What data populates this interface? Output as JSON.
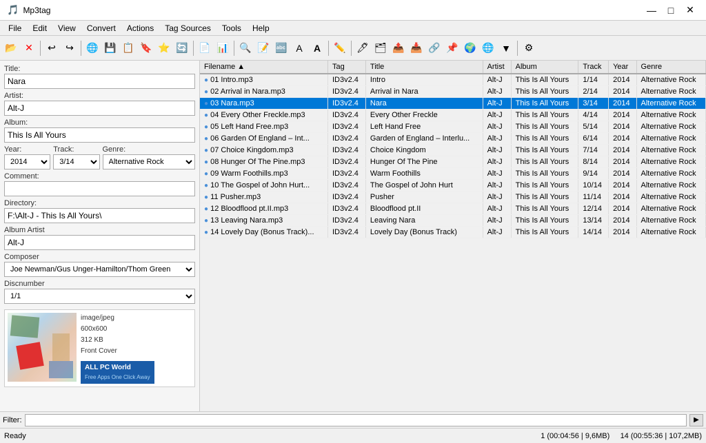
{
  "app": {
    "title": "Mp3tag",
    "icon": "🎵"
  },
  "titlebar": {
    "minimize": "—",
    "maximize": "□",
    "close": "✕"
  },
  "menu": {
    "items": [
      "File",
      "Edit",
      "View",
      "Convert",
      "Actions",
      "Tag Sources",
      "Tools",
      "Help"
    ]
  },
  "left_panel": {
    "title_label": "Title:",
    "title_value": "Nara",
    "artist_label": "Artist:",
    "artist_value": "Alt-J",
    "album_label": "Album:",
    "album_value": "This Is All Yours",
    "year_label": "Year:",
    "year_value": "2014",
    "track_label": "Track:",
    "track_value": "3/14",
    "genre_label": "Genre:",
    "genre_value": "Alternative Rock",
    "comment_label": "Comment:",
    "comment_value": "",
    "directory_label": "Directory:",
    "directory_value": "F:\\Alt-J - This Is All Yours\\",
    "album_artist_label": "Album Artist",
    "album_artist_value": "Alt-J",
    "composer_label": "Composer",
    "composer_value": "Joe Newman/Gus Unger-Hamilton/Thom Green",
    "discnumber_label": "Discnumber",
    "discnumber_value": "1/1",
    "art_type": "image/jpeg",
    "art_dims": "600x600",
    "art_size": "312 KB",
    "art_label": "Front Cover",
    "watermark_title": "ALL PC World",
    "watermark_sub": "Free Apps One Click Away"
  },
  "table": {
    "columns": [
      "Filename",
      "Tag",
      "Title",
      "Artist",
      "Album",
      "Track",
      "Year",
      "Genre"
    ],
    "rows": [
      {
        "filename": "01 Intro.mp3",
        "tag": "ID3v2.4",
        "title": "Intro",
        "artist": "Alt-J",
        "album": "This Is All Yours",
        "track": "1/14",
        "year": "2014",
        "genre": "Alternative Rock",
        "selected": false
      },
      {
        "filename": "02 Arrival in Nara.mp3",
        "tag": "ID3v2.4",
        "title": "Arrival in Nara",
        "artist": "Alt-J",
        "album": "This Is All Yours",
        "track": "2/14",
        "year": "2014",
        "genre": "Alternative Rock",
        "selected": false
      },
      {
        "filename": "03 Nara.mp3",
        "tag": "ID3v2.4",
        "title": "Nara",
        "artist": "Alt-J",
        "album": "This Is All Yours",
        "track": "3/14",
        "year": "2014",
        "genre": "Alternative Rock",
        "selected": true
      },
      {
        "filename": "04 Every Other Freckle.mp3",
        "tag": "ID3v2.4",
        "title": "Every Other Freckle",
        "artist": "Alt-J",
        "album": "This Is All Yours",
        "track": "4/14",
        "year": "2014",
        "genre": "Alternative Rock",
        "selected": false
      },
      {
        "filename": "05 Left Hand Free.mp3",
        "tag": "ID3v2.4",
        "title": "Left Hand Free",
        "artist": "Alt-J",
        "album": "This Is All Yours",
        "track": "5/14",
        "year": "2014",
        "genre": "Alternative Rock",
        "selected": false
      },
      {
        "filename": "06 Garden Of England – Int...",
        "tag": "ID3v2.4",
        "title": "Garden of England – Interlu...",
        "artist": "Alt-J",
        "album": "This Is All Yours",
        "track": "6/14",
        "year": "2014",
        "genre": "Alternative Rock",
        "selected": false
      },
      {
        "filename": "07 Choice Kingdom.mp3",
        "tag": "ID3v2.4",
        "title": "Choice Kingdom",
        "artist": "Alt-J",
        "album": "This Is All Yours",
        "track": "7/14",
        "year": "2014",
        "genre": "Alternative Rock",
        "selected": false
      },
      {
        "filename": "08 Hunger Of The Pine.mp3",
        "tag": "ID3v2.4",
        "title": "Hunger Of The Pine",
        "artist": "Alt-J",
        "album": "This Is All Yours",
        "track": "8/14",
        "year": "2014",
        "genre": "Alternative Rock",
        "selected": false
      },
      {
        "filename": "09 Warm Foothills.mp3",
        "tag": "ID3v2.4",
        "title": "Warm Foothills",
        "artist": "Alt-J",
        "album": "This Is All Yours",
        "track": "9/14",
        "year": "2014",
        "genre": "Alternative Rock",
        "selected": false
      },
      {
        "filename": "10 The Gospel of John Hurt...",
        "tag": "ID3v2.4",
        "title": "The Gospel of John Hurt",
        "artist": "Alt-J",
        "album": "This Is All Yours",
        "track": "10/14",
        "year": "2014",
        "genre": "Alternative Rock",
        "selected": false
      },
      {
        "filename": "11 Pusher.mp3",
        "tag": "ID3v2.4",
        "title": "Pusher",
        "artist": "Alt-J",
        "album": "This Is All Yours",
        "track": "11/14",
        "year": "2014",
        "genre": "Alternative Rock",
        "selected": false
      },
      {
        "filename": "12 Bloodflood pt.II.mp3",
        "tag": "ID3v2.4",
        "title": "Bloodflood pt.II",
        "artist": "Alt-J",
        "album": "This Is All Yours",
        "track": "12/14",
        "year": "2014",
        "genre": "Alternative Rock",
        "selected": false
      },
      {
        "filename": "13 Leaving Nara.mp3",
        "tag": "ID3v2.4",
        "title": "Leaving Nara",
        "artist": "Alt-J",
        "album": "This Is All Yours",
        "track": "13/14",
        "year": "2014",
        "genre": "Alternative Rock",
        "selected": false
      },
      {
        "filename": "14 Lovely Day (Bonus Track)...",
        "tag": "ID3v2.4",
        "title": "Lovely Day (Bonus Track)",
        "artist": "Alt-J",
        "album": "This Is All Yours",
        "track": "14/14",
        "year": "2014",
        "genre": "Alternative Rock",
        "selected": false
      }
    ]
  },
  "filter": {
    "label": "Filter:",
    "placeholder": "",
    "btn": "▶"
  },
  "status": {
    "ready": "Ready",
    "selected_info": "1 (00:04:56 | 9,6MB)",
    "total_info": "14 (00:55:36 | 107,2MB)"
  }
}
